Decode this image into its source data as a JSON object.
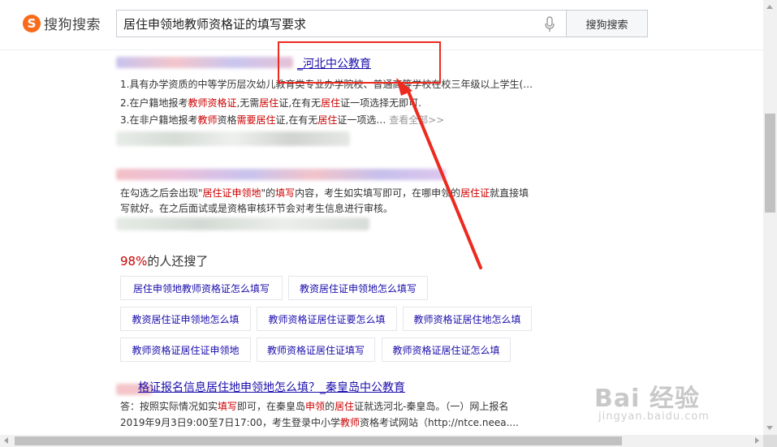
{
  "header": {
    "logo_glyph": "S",
    "logo_text": "搜狗搜索",
    "search_value": "居住申领地教师资格证的填写要求",
    "search_button": "搜狗搜索"
  },
  "result1": {
    "title_visible": "_河北中公教育",
    "lines": [
      [
        "1.具有办学资质的中等学历层次幼儿教育类专业办学院校、普通高等学校在校三年级以上学生(…",
        "",
        "",
        "",
        ""
      ],
      [
        "2.在户籍地报考",
        "教师资格证",
        ",无需",
        "居住",
        "证,在有无",
        "居住",
        "证一项选择无即可."
      ],
      [
        "3.在非户籍地报考",
        "教师",
        "资格",
        "需要居住",
        "证,在有无",
        "居住",
        "证一项选…",
        "查看全部>>"
      ]
    ]
  },
  "result2": {
    "line1": [
      "在勾选之后会出现\"",
      "居住证申领地",
      "\"的",
      "填写",
      "内容，考生如实填写即可，在哪申领的",
      "居住证",
      "就直接填"
    ],
    "line2": "写就好。在之后面试或是资格审核环节会对考生信息进行审核。"
  },
  "also": {
    "pct": "98%",
    "text": "的人还搜了",
    "chips": [
      "居住申领地教师资格证怎么填写",
      "教资居住证申领地怎么填写",
      "教资居住证申领地怎么填",
      "教师资格证居住证要怎么填",
      "教师资格证居住地怎么填",
      "教师资格证居住证申领地",
      "教师资格证居住证填写",
      "教师资格证居住证怎么填"
    ]
  },
  "result3": {
    "title": "格证报名信息居住地申领地怎么填？_秦皇岛中公教育",
    "line1": [
      "答：按照实际情况如实",
      "填写",
      "即可，在秦皇岛",
      "申领",
      "的",
      "居住",
      "证就选河北-秦皇岛。（一）网上报名"
    ],
    "line2": [
      "2019年9月3日9:00至7日17:00，考生登录中小学",
      "教师",
      "资格考试网站（http://ntce.neea...."
    ]
  },
  "watermark": {
    "text": "Bai 经验",
    "sub": "jingyan.baidu.com"
  },
  "colors": {
    "accent": "#f96b1b",
    "link": "#1a0dab",
    "highlight": "#cc0000",
    "annotation_red": "#ec2a1f"
  }
}
